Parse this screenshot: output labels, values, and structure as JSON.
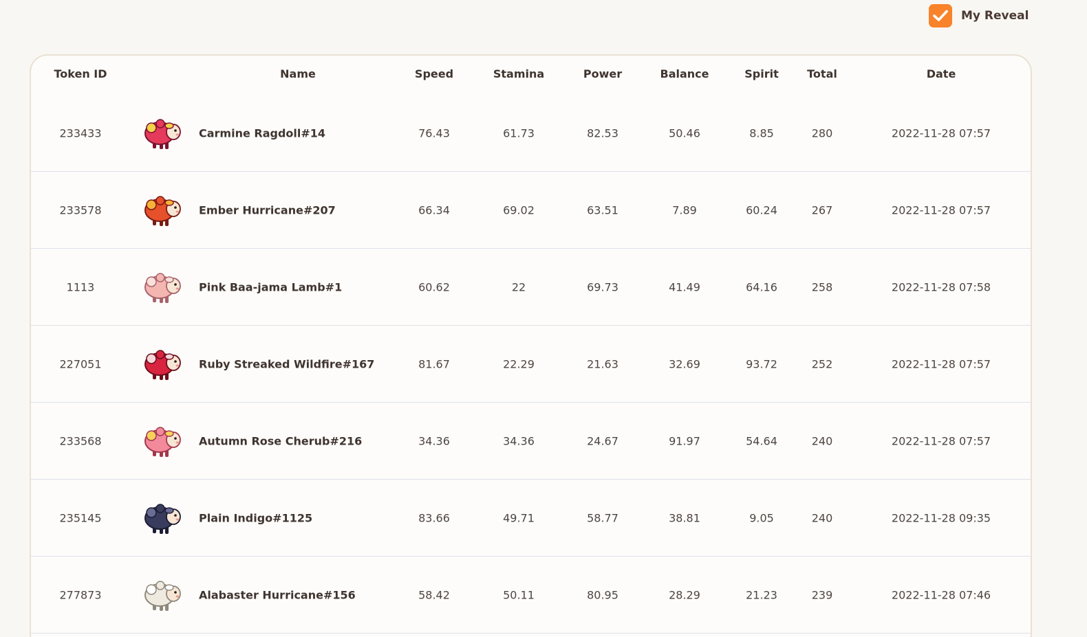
{
  "toggle": {
    "label": "My Reveal",
    "checked": true,
    "color": "#f8832b"
  },
  "columns": [
    "Token ID",
    "Name",
    "Speed",
    "Stamina",
    "Power",
    "Balance",
    "Spirit",
    "Total",
    "Date"
  ],
  "rows": [
    {
      "token_id": "233433",
      "name": "Carmine Ragdoll#14",
      "speed": "76.43",
      "stamina": "61.73",
      "power": "82.53",
      "balance": "50.46",
      "spirit": "8.85",
      "total": "280",
      "date": "2022-11-28 07:57",
      "avatar": {
        "icon": "sheep-avatar",
        "body": "#e63a5c",
        "accent": "#f4d24a",
        "dark": "#7a1230"
      }
    },
    {
      "token_id": "233578",
      "name": "Ember Hurricane#207",
      "speed": "66.34",
      "stamina": "69.02",
      "power": "63.51",
      "balance": "7.89",
      "spirit": "60.24",
      "total": "267",
      "date": "2022-11-28 07:57",
      "avatar": {
        "icon": "sheep-avatar",
        "body": "#e6502a",
        "accent": "#f7b338",
        "dark": "#7a1a14"
      }
    },
    {
      "token_id": "1113",
      "name": "Pink Baa-jama Lamb#1",
      "speed": "60.62",
      "stamina": "22",
      "power": "69.73",
      "balance": "41.49",
      "spirit": "64.16",
      "total": "258",
      "date": "2022-11-28 07:58",
      "avatar": {
        "icon": "sheep-avatar",
        "body": "#f4b6b0",
        "accent": "#fbe1dc",
        "dark": "#a8636a"
      }
    },
    {
      "token_id": "227051",
      "name": "Ruby Streaked Wildfire#167",
      "speed": "81.67",
      "stamina": "22.29",
      "power": "21.63",
      "balance": "32.69",
      "spirit": "93.72",
      "total": "252",
      "date": "2022-11-28 07:57",
      "avatar": {
        "icon": "sheep-avatar",
        "body": "#d8243f",
        "accent": "#f7d6da",
        "dark": "#6b0e1d"
      }
    },
    {
      "token_id": "233568",
      "name": "Autumn Rose Cherub#216",
      "speed": "34.36",
      "stamina": "34.36",
      "power": "24.67",
      "balance": "91.97",
      "spirit": "54.64",
      "total": "240",
      "date": "2022-11-28 07:57",
      "avatar": {
        "icon": "sheep-avatar",
        "body": "#f28a9c",
        "accent": "#f7d25a",
        "dark": "#a3384c"
      }
    },
    {
      "token_id": "235145",
      "name": "Plain Indigo#1125",
      "speed": "83.66",
      "stamina": "49.71",
      "power": "58.77",
      "balance": "38.81",
      "spirit": "9.05",
      "total": "240",
      "date": "2022-11-28 09:35",
      "avatar": {
        "icon": "sheep-avatar",
        "body": "#3a3c5e",
        "accent": "#6a6d94",
        "dark": "#1c1d33"
      }
    },
    {
      "token_id": "277873",
      "name": "Alabaster Hurricane#156",
      "speed": "58.42",
      "stamina": "50.11",
      "power": "80.95",
      "balance": "28.29",
      "spirit": "21.23",
      "total": "239",
      "date": "2022-11-28 07:46",
      "avatar": {
        "icon": "sheep-avatar",
        "body": "#eeeae0",
        "accent": "#ffffff",
        "dark": "#8f897c"
      }
    }
  ]
}
